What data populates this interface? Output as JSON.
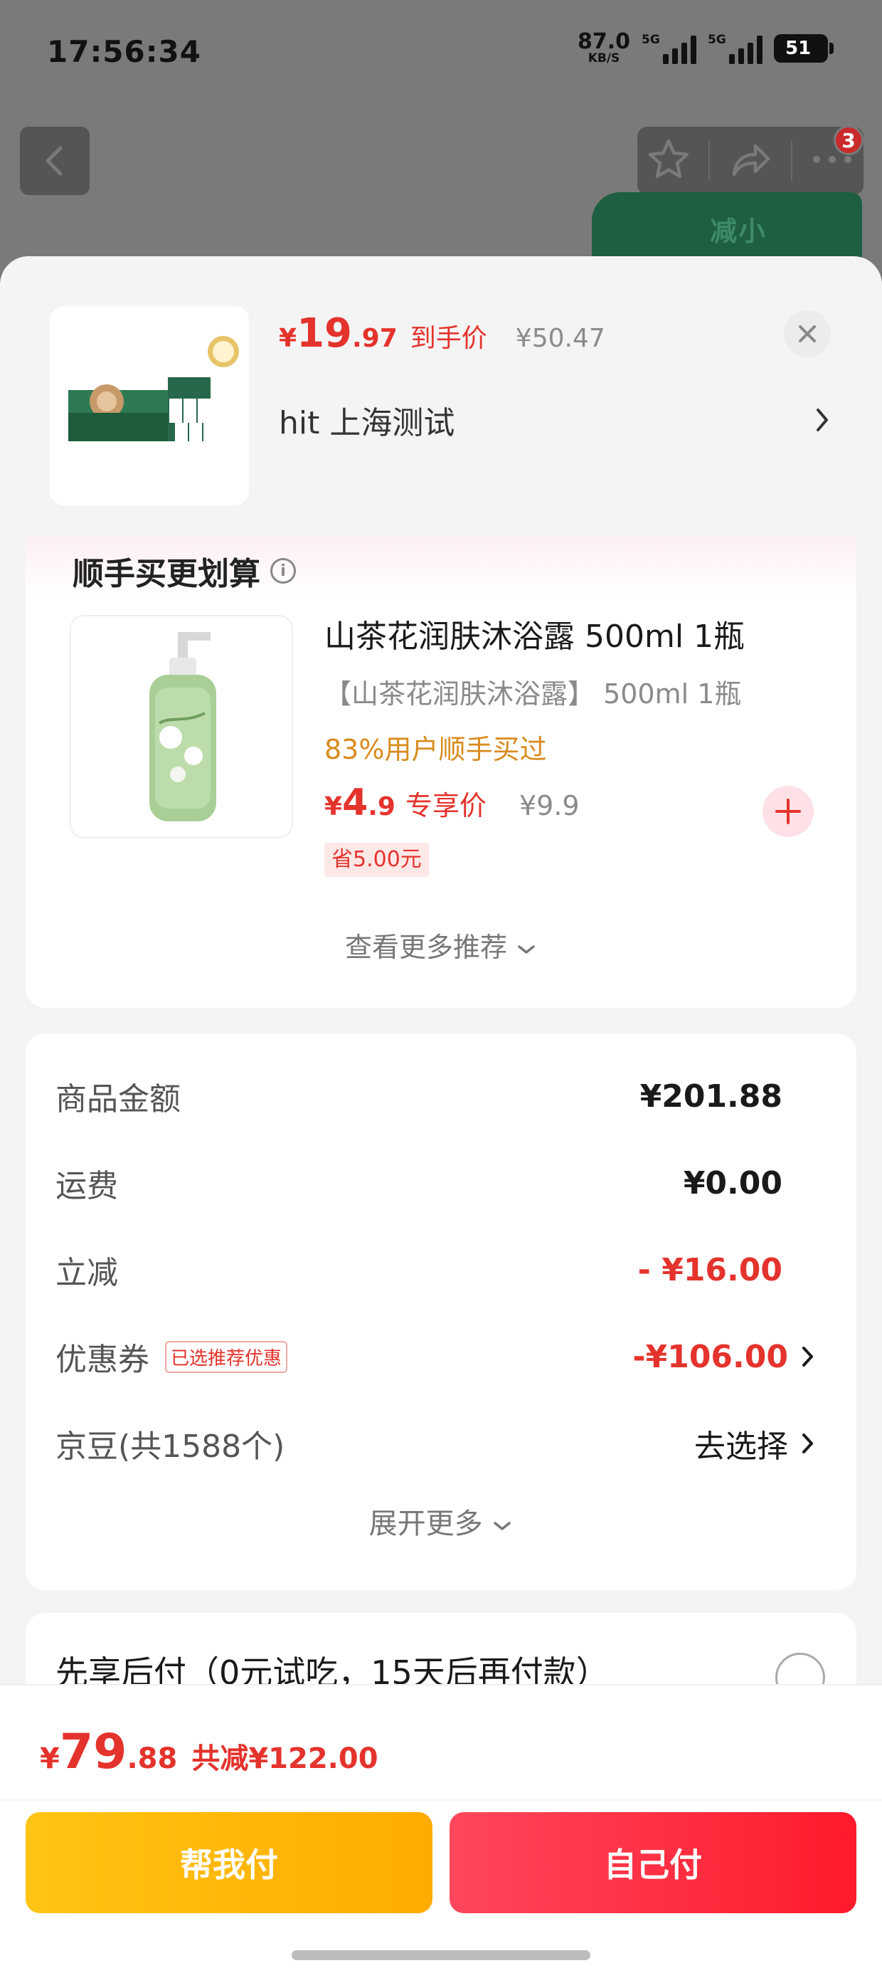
{
  "status_bar": {
    "time": "17:56:34",
    "net_speed": "87.0",
    "net_unit": "KB/S",
    "signal_1": "5G",
    "signal_2": "5G",
    "battery": "51"
  },
  "background_nav": {
    "badge_count": "3",
    "banner_text": "减小"
  },
  "product": {
    "currency": "¥",
    "price_int": "19",
    "price_dec": ".97",
    "price_label": "到手价",
    "original_price": "¥50.47",
    "address": "hit  上海测试"
  },
  "addon": {
    "title": "顺手买更划算",
    "name": "山茶花润肤沐浴露 500ml 1瓶",
    "spec": "【山茶花润肤沐浴露】 500ml 1瓶",
    "popularity": "83%用户顺手买过",
    "currency": "¥",
    "price_int": "4",
    "price_dec": ".9",
    "price_label": "专享价",
    "original_price": "¥9.9",
    "save_tag": "省5.00元",
    "more_label": "查看更多推荐"
  },
  "cost_summary": {
    "rows": [
      {
        "label": "商品金额",
        "value": "¥201.88"
      },
      {
        "label": "运费",
        "value": "¥0.00"
      },
      {
        "label": "立减",
        "value": "- ¥16.00"
      },
      {
        "label": "优惠券",
        "tag": "已选推荐优惠",
        "value": "-¥106.00"
      },
      {
        "label": "京豆(共1588个)",
        "value": "去选择"
      }
    ],
    "expand_label": "展开更多"
  },
  "bnpl": {
    "label": "先享后付（0元试吃，15天后再付款）"
  },
  "footer": {
    "currency": "¥",
    "total_int": "79",
    "total_dec": ".88",
    "saved": "共减¥122.00",
    "help_pay": "帮我付",
    "self_pay": "自己付"
  },
  "colors": {
    "accent_red": "#e4332c",
    "help_button": "#ffb800",
    "self_button": "#ff2a3c",
    "popularity": "#d98b1e"
  },
  "icons": [
    "back-icon",
    "star-icon",
    "share-icon",
    "more-icon",
    "close-icon",
    "info-icon",
    "plus-icon",
    "chevron-right-icon",
    "chevron-down-icon"
  ]
}
